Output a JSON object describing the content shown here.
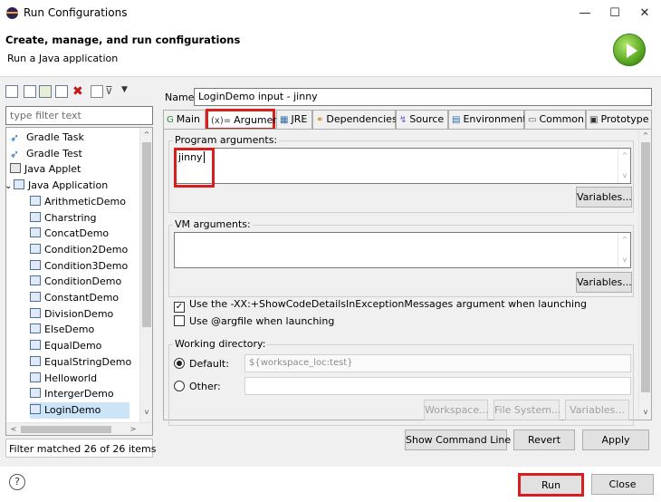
{
  "window": {
    "title": "Run Configurations",
    "minimize": "—",
    "maximize": "☐",
    "close": "✕"
  },
  "header": {
    "title": "Create, manage, and run configurations",
    "subtitle": "Run a Java application"
  },
  "left": {
    "filter_placeholder": "type filter text",
    "tree": [
      {
        "label": "Gradle Task",
        "icon": "gradle-icon",
        "indent": 0
      },
      {
        "label": "Gradle Test",
        "icon": "gradle-icon",
        "indent": 0
      },
      {
        "label": "Java Applet",
        "icon": "applet-icon",
        "indent": 0
      },
      {
        "label": "Java Application",
        "icon": "java-app-icon",
        "indent": 0,
        "expanded": true
      },
      {
        "label": "ArithmeticDemo",
        "icon": "java-config-icon",
        "indent": 1
      },
      {
        "label": "Charstring",
        "icon": "java-config-icon",
        "indent": 1
      },
      {
        "label": "ConcatDemo",
        "icon": "java-config-icon",
        "indent": 1
      },
      {
        "label": "Condition2Demo",
        "icon": "java-config-icon",
        "indent": 1
      },
      {
        "label": "Condition3Demo",
        "icon": "java-config-icon",
        "indent": 1
      },
      {
        "label": "ConditionDemo",
        "icon": "java-config-icon",
        "indent": 1
      },
      {
        "label": "ConstantDemo",
        "icon": "java-config-icon",
        "indent": 1
      },
      {
        "label": "DivisionDemo",
        "icon": "java-config-icon",
        "indent": 1
      },
      {
        "label": "ElseDemo",
        "icon": "java-config-icon",
        "indent": 1
      },
      {
        "label": "EqualDemo",
        "icon": "java-config-icon",
        "indent": 1
      },
      {
        "label": "EqualStringDemo",
        "icon": "java-config-icon",
        "indent": 1
      },
      {
        "label": "Helloworld",
        "icon": "java-config-icon",
        "indent": 1
      },
      {
        "label": "IntergerDemo",
        "icon": "java-config-icon",
        "indent": 1
      },
      {
        "label": "LoginDemo",
        "icon": "java-config-icon",
        "indent": 1,
        "selected": true
      }
    ],
    "status": "Filter matched 26 of 26 items"
  },
  "config": {
    "name_label": "Name:",
    "name_value": "LoginDemo input - jinny",
    "tabs": [
      {
        "label": "Main",
        "icon": "main-tab-icon"
      },
      {
        "label": "Arguments",
        "icon": "arguments-tab-icon",
        "active": true
      },
      {
        "label": "JRE",
        "icon": "jre-tab-icon"
      },
      {
        "label": "Dependencies",
        "icon": "dependencies-tab-icon"
      },
      {
        "label": "Source",
        "icon": "source-tab-icon"
      },
      {
        "label": "Environment",
        "icon": "environment-tab-icon"
      },
      {
        "label": "Common",
        "icon": "common-tab-icon"
      },
      {
        "label": "Prototype",
        "icon": "prototype-tab-icon"
      }
    ],
    "program_args_label": "Program arguments:",
    "program_args_value": "jinny",
    "variables_label": "Variables...",
    "vm_args_label": "VM arguments:",
    "vm_args_value": "",
    "show_code_details_label": "Use the -XX:+ShowCodeDetailsInExceptionMessages argument when launching",
    "show_code_details_checked": true,
    "argfile_label": "Use @argfile when launching",
    "argfile_checked": false,
    "working_dir_label": "Working directory:",
    "default_label": "Default:",
    "default_value": "${workspace_loc:test}",
    "other_label": "Other:",
    "workspace_btn": "Workspace...",
    "filesystem_btn": "File System...",
    "variables_btn_dir": "Variables..."
  },
  "buttons": {
    "show_command_line": "Show Command Line",
    "revert": "Revert",
    "apply": "Apply",
    "run": "Run",
    "close": "Close",
    "help": "?"
  },
  "colors": {
    "highlight_red": "#d7201d",
    "selection": "#cce4f7"
  }
}
